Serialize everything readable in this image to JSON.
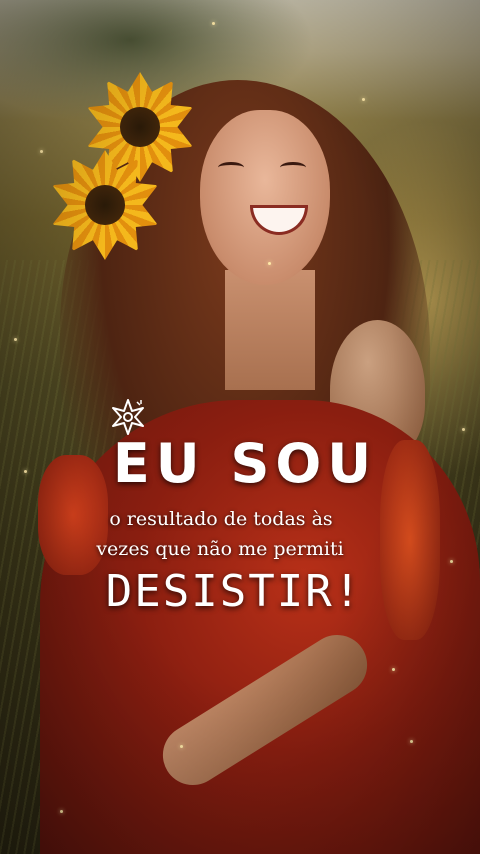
{
  "quote": {
    "headline": "EU SOU",
    "line1": "o resultado de todas às",
    "line2": "vezes que não me permiti",
    "emphasis": "DESISTIR!"
  },
  "decoration": {
    "icon": "flower-icon"
  },
  "colors": {
    "text": "#ffffff",
    "dress": "#a8281a",
    "sunflower": "#f4b81c",
    "background": "#6e5f2c"
  }
}
